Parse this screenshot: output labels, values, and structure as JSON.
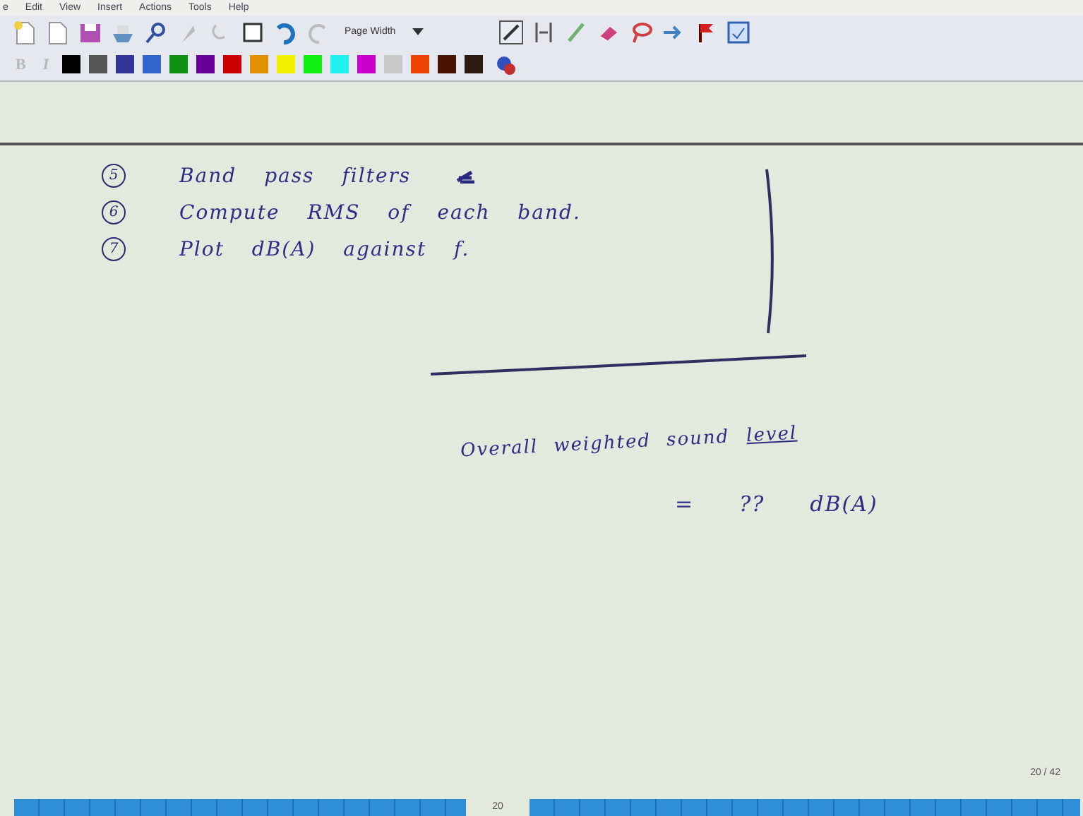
{
  "menu": [
    {
      "label": "e"
    },
    {
      "label": "Edit"
    },
    {
      "label": "View"
    },
    {
      "label": "Insert"
    },
    {
      "label": "Actions"
    },
    {
      "label": "Tools"
    },
    {
      "label": "Help"
    }
  ],
  "toolbar": {
    "zoom_dropdown": {
      "value": "Page Width"
    },
    "format_buttons": [
      {
        "label": "B",
        "disabled": true
      },
      {
        "label": "I",
        "disabled": true
      }
    ],
    "pen_colors": [
      {
        "color": "#000000"
      },
      {
        "color": "#555555"
      },
      {
        "color": "#333399"
      },
      {
        "color": "#3366cc"
      },
      {
        "color": "#109010"
      },
      {
        "color": "#660099"
      },
      {
        "color": "#cc0000"
      },
      {
        "color": "#e09000"
      },
      {
        "color": "#f0f000"
      },
      {
        "color": "#10f010"
      },
      {
        "color": "#20f0f0"
      },
      {
        "color": "#cc00cc"
      },
      {
        "color": "#c8c8c8"
      },
      {
        "color": "#ee4400"
      },
      {
        "color": "#4a1400"
      },
      {
        "color": "#2a1a10"
      }
    ]
  },
  "note": {
    "steps": [
      {
        "number": "5",
        "text": "Band pass filters"
      },
      {
        "number": "6",
        "text": "Compute RMS of each band."
      },
      {
        "number": "7",
        "text": "Plot dB(A) against f."
      }
    ],
    "summary": [
      {
        "text": "Overall weighted sound",
        "underlined": false
      },
      {
        "text": "level",
        "underlined": true
      }
    ],
    "result": [
      {
        "text": "="
      },
      {
        "text": "??"
      },
      {
        "text": "dB(A)"
      }
    ]
  },
  "page_number": "20 / 42",
  "page_strip": {
    "label": "20"
  }
}
